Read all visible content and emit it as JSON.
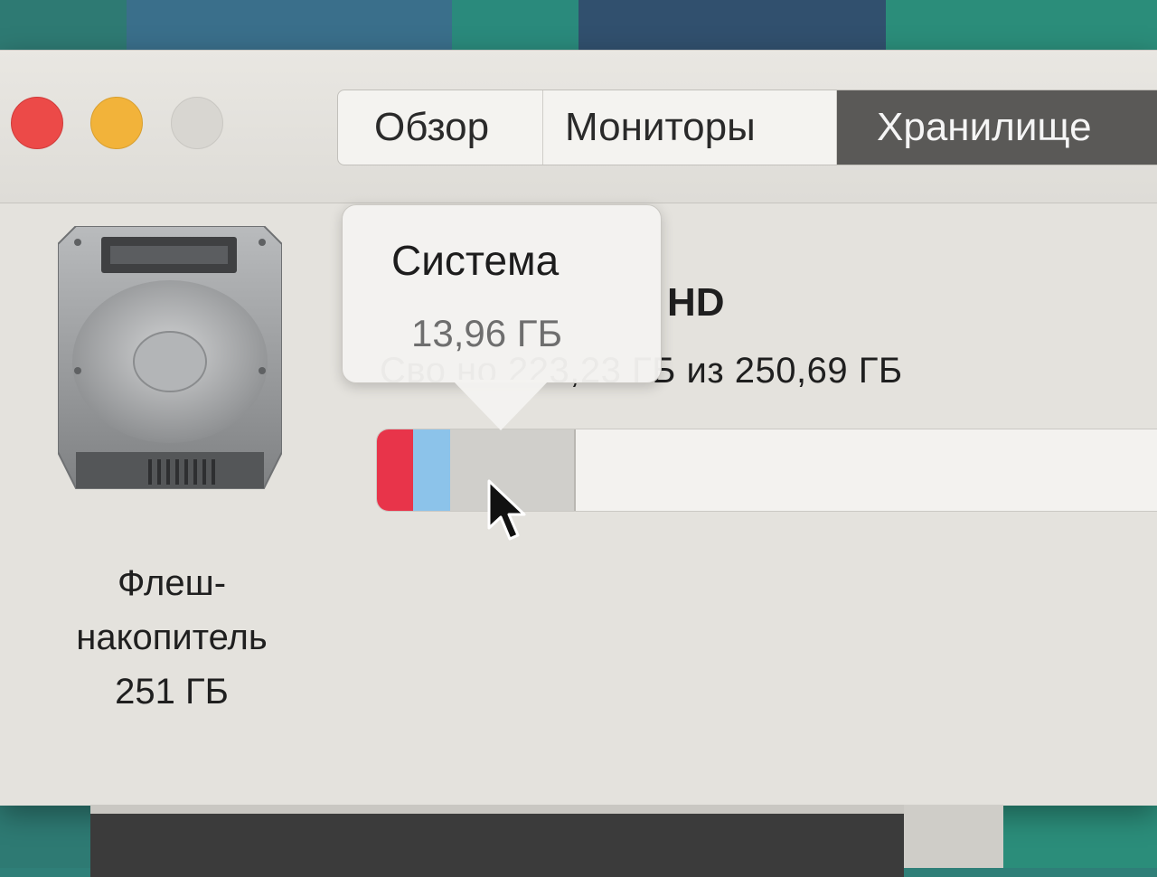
{
  "window": {
    "tabs": [
      {
        "label": "Обзор"
      },
      {
        "label": "Мониторы"
      },
      {
        "label": "Хранилище"
      }
    ],
    "active_tab": "Хранилище"
  },
  "drive": {
    "icon": "hard-drive-icon",
    "label_line1": "Флеш-",
    "label_line2": "накопитель",
    "label_line3": "251 ГБ"
  },
  "disk": {
    "name_visible": "HD",
    "free_text": "Сво     но 223,23 ГБ из 250,69 ГБ"
  },
  "storage_bar": {
    "segments": [
      {
        "name": "red",
        "color": "#e8344a",
        "fraction": 0.045
      },
      {
        "name": "blue",
        "color": "#8cc3ea",
        "fraction": 0.047
      },
      {
        "name": "system",
        "color": "#d0cfcb",
        "fraction": 0.156
      }
    ],
    "free_color": "#f3f2ef"
  },
  "tooltip": {
    "title": "Система",
    "value": "13,96 ГБ"
  },
  "colors": {
    "close": "#ec4a48",
    "minimize": "#f2b33a",
    "zoom_disabled": "#d8d6d1",
    "active_tab_bg": "#5a5957"
  }
}
